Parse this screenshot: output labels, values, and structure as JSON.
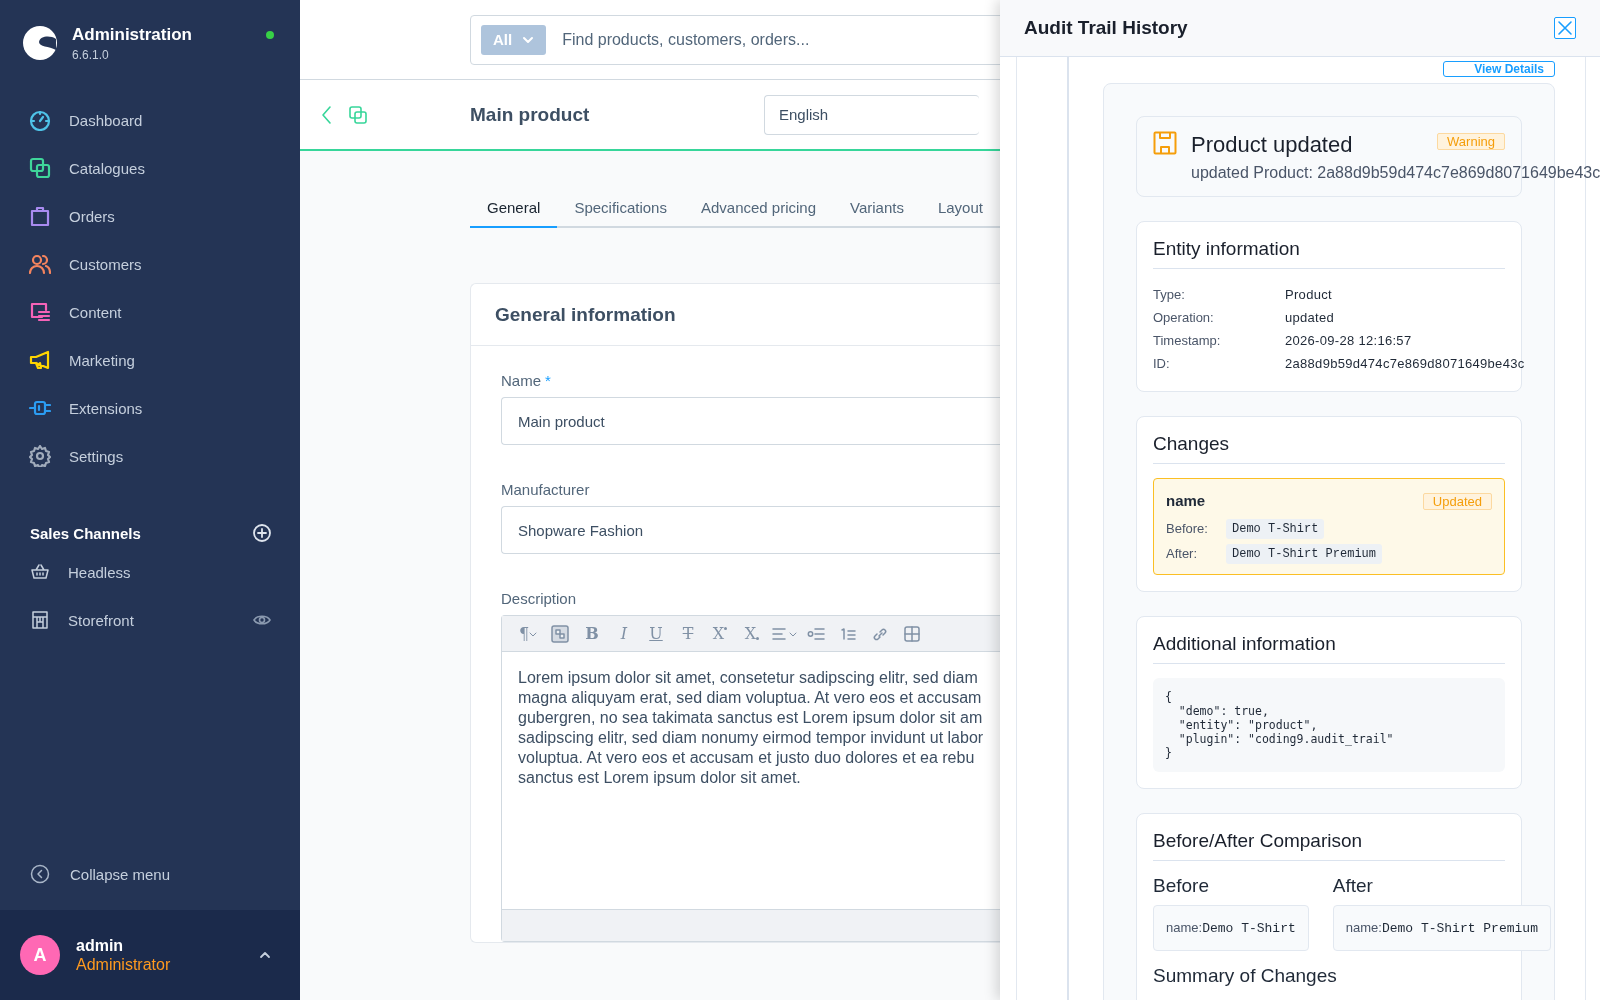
{
  "brand": {
    "title": "Administration",
    "version": "6.6.1.0",
    "online": true
  },
  "nav": [
    {
      "label": "Dashboard",
      "color": "#4fc3e8"
    },
    {
      "label": "Catalogues",
      "color": "#3fd59a"
    },
    {
      "label": "Orders",
      "color": "#a98bf0"
    },
    {
      "label": "Customers",
      "color": "#f5845e"
    },
    {
      "label": "Content",
      "color": "#f563b8"
    },
    {
      "label": "Marketing",
      "color": "#ffd500"
    },
    {
      "label": "Extensions",
      "color": "#2b9cf2"
    },
    {
      "label": "Settings",
      "color": "#a0abbb"
    }
  ],
  "sales_channels": {
    "title": "Sales Channels",
    "items": [
      {
        "label": "Headless",
        "preview": false
      },
      {
        "label": "Storefront",
        "preview": true
      }
    ]
  },
  "collapse": "Collapse menu",
  "user": {
    "initial": "A",
    "name": "admin",
    "role": "Administrator"
  },
  "search": {
    "scope": "All",
    "placeholder": "Find products, customers, orders..."
  },
  "page": {
    "title": "Main product",
    "language": "English"
  },
  "tabs": [
    {
      "label": "General",
      "selected": true
    },
    {
      "label": "Specifications",
      "selected": false
    },
    {
      "label": "Advanced pricing",
      "selected": false
    },
    {
      "label": "Variants",
      "selected": false
    },
    {
      "label": "Layout",
      "selected": false
    }
  ],
  "general": {
    "title": "General information",
    "fields": [
      {
        "label": "Name",
        "marker": "*",
        "value": "Main product"
      },
      {
        "label": "Manufacturer",
        "value": "Shopware Fashion"
      }
    ],
    "description": {
      "label": "Description",
      "toolbar": [
        {
          "kind": "paragraph",
          "glyph": "¶"
        },
        {
          "kind": "checker"
        },
        {
          "kind": "bold",
          "glyph": "B"
        },
        {
          "kind": "italic",
          "glyph": "I"
        },
        {
          "kind": "underline",
          "glyph": "U"
        },
        {
          "kind": "strike",
          "glyph": "T"
        },
        {
          "kind": "superscript",
          "glyph": "X"
        },
        {
          "kind": "subscript",
          "glyph": "X"
        },
        {
          "kind": "align"
        },
        {
          "kind": "bullets"
        },
        {
          "kind": "numbers"
        },
        {
          "kind": "link"
        },
        {
          "kind": "table"
        }
      ],
      "lines": [
        "Lorem ipsum dolor sit amet, consetetur sadipscing elitr, sed diam",
        "magna aliquyam erat, sed diam voluptua. At vero eos et accusam",
        "gubergren, no sea takimata sanctus est Lorem ipsum dolor sit am",
        "sadipscing elitr, sed diam nonumy eirmod tempor invidunt ut labor",
        "voluptua. At vero eos et accusam et justo duo dolores et ea rebu",
        "sanctus est Lorem ipsum dolor sit amet."
      ]
    }
  },
  "audit": {
    "title": "Audit Trail History",
    "view_details": "View Details",
    "event": {
      "title": "Product updated",
      "badge": "Warning",
      "subtitle": "updated Product: 2a88d9b59d474c7e869d8071649be43c"
    },
    "entity": {
      "title": "Entity information",
      "rows": [
        {
          "label": "Type:",
          "value": "Product"
        },
        {
          "label": "Operation:",
          "value": "updated"
        },
        {
          "label": "Timestamp:",
          "value": "2026-09-28 12:16:57"
        },
        {
          "label": "ID:",
          "value": "2a88d9b59d474c7e869d8071649be43c"
        }
      ]
    },
    "changes": {
      "title": "Changes",
      "items": [
        {
          "field": "name",
          "badge": "Updated",
          "rows": [
            {
              "label": "Before:",
              "value": "Demo T-Shirt"
            },
            {
              "label": "After:",
              "value": "Demo T-Shirt Premium"
            }
          ]
        }
      ]
    },
    "additional": {
      "title": "Additional information",
      "code": "{\n  \"demo\": true,\n  \"entity\": \"product\",\n  \"plugin\": \"coding9.audit_trail\"\n}"
    },
    "comparison": {
      "title": "Before/After Comparison",
      "columns": [
        {
          "heading": "Before",
          "key": "name:",
          "value": "Demo T-Shirt"
        },
        {
          "heading": "After",
          "key": "name:",
          "value": "Demo T-Shirt Premium"
        }
      ]
    },
    "summary_title": "Summary of Changes"
  }
}
